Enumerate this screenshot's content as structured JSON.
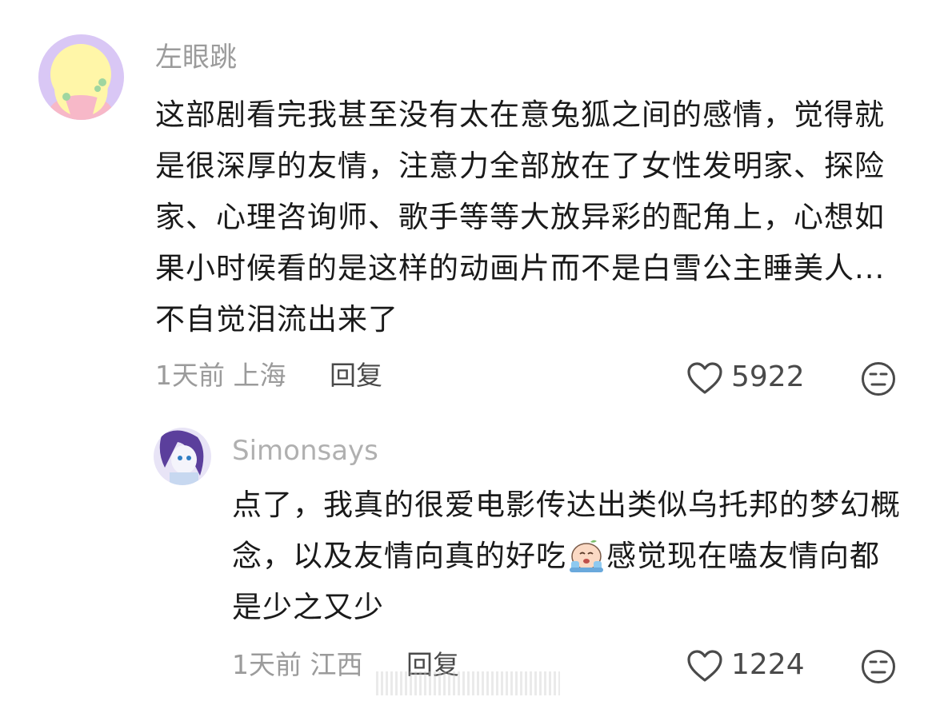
{
  "comments": [
    {
      "username": "左眼跳",
      "text": "这部剧看完我甚至没有太在意兔狐之间的感情，觉得就是很深厚的友情，注意力全部放在了女性发明家、探险家、心理咨询师、歌手等等大放异彩的配角上，心想如果小时候看的是这样的动画片而不是白雪公主睡美人...不自觉泪流出来了",
      "time": "1天前",
      "location": "上海",
      "reply_label": "回复",
      "likes": "5922",
      "avatar_icon": "cartoon-girl-avatar"
    },
    {
      "username": "Simonsays",
      "text_before_emoji": "点了，我真的很爱电影传达出类似乌托邦的梦幻概念，以及友情向真的好吃",
      "text_after_emoji": "感觉现在嗑友情向都是少之又少",
      "time": "1天前",
      "location": "江西",
      "reply_label": "回复",
      "likes": "1224",
      "avatar_icon": "pony-girl-avatar",
      "inline_emoji": "crying-face-emoji"
    }
  ],
  "icons": {
    "like": "heart-outline-icon",
    "emoji": "neutral-face-icon"
  },
  "colors": {
    "secondary_text": "#9b9b9b",
    "primary_text": "#1a1a1a",
    "icon_stroke": "#4a4a4a"
  }
}
